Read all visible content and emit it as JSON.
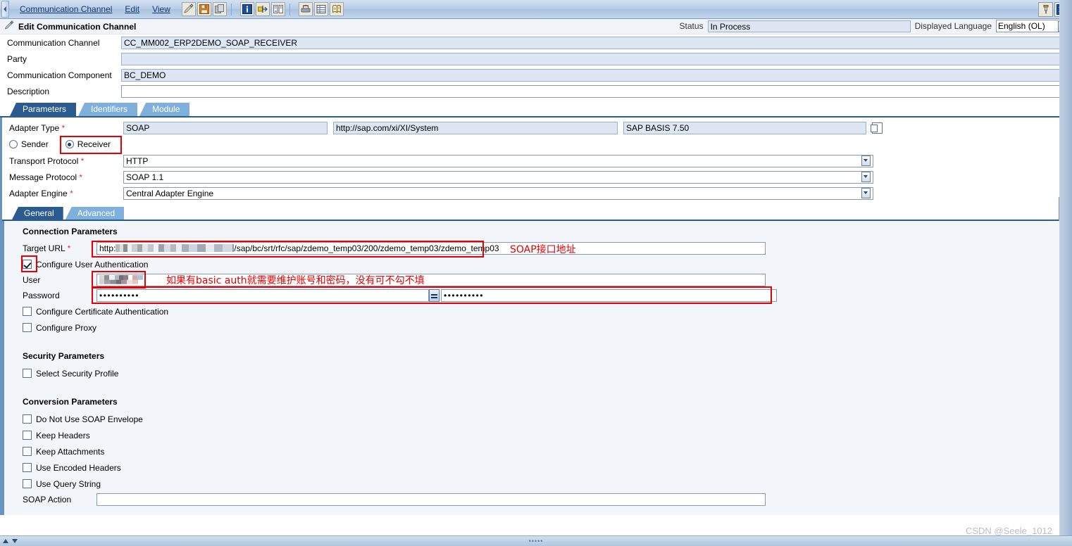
{
  "menu": {
    "items": [
      {
        "label": "Communication Channel",
        "accel": "C"
      },
      {
        "label": "Edit",
        "accel": "d"
      },
      {
        "label": "View",
        "accel": "i"
      }
    ],
    "toolbar_group1": [
      {
        "name": "edit-pencil-icon",
        "title": "Edit"
      },
      {
        "name": "save-icon",
        "title": "Save"
      },
      {
        "name": "copy-icon",
        "title": "Copy"
      }
    ],
    "toolbar_group2": [
      {
        "name": "info-icon",
        "title": "Information"
      },
      {
        "name": "where-used-icon",
        "title": "Where Used"
      },
      {
        "name": "compare-icon",
        "title": "Compare"
      }
    ],
    "toolbar_group3": [
      {
        "name": "print-icon",
        "title": "Print"
      },
      {
        "name": "grid-icon",
        "title": "Table"
      },
      {
        "name": "history-icon",
        "title": "History"
      }
    ],
    "window_controls": [
      {
        "name": "pin-icon",
        "title": "Pin Window"
      },
      {
        "name": "close-icon",
        "title": "Close"
      }
    ]
  },
  "header": {
    "icon": "channel-icon",
    "title": "Edit Communication Channel",
    "status_label": "Status",
    "status_value": "In Process",
    "language_label": "Displayed Language",
    "language_value": "English (OL)"
  },
  "form": {
    "rows": [
      {
        "label": "Communication Channel",
        "value": "CC_MM002_ERP2DEMO_SOAP_RECEIVER",
        "editable": false
      },
      {
        "label": "Party",
        "value": "",
        "editable": false
      },
      {
        "label": "Communication Component",
        "value": "BC_DEMO",
        "editable": false
      },
      {
        "label": "Description",
        "value": "",
        "editable": true
      }
    ]
  },
  "tabs": {
    "items": [
      {
        "label": "Parameters",
        "active": true
      },
      {
        "label": "Identifiers",
        "active": false
      },
      {
        "label": "Module",
        "active": false
      }
    ]
  },
  "parameters": {
    "adapter_type_label": "Adapter Type",
    "adapter_type_value": "SOAP",
    "adapter_namespace": "http://sap.com/xi/XI/System",
    "adapter_swcv": "SAP BASIS 7.50",
    "direction": {
      "sender_label": "Sender",
      "receiver_label": "Receiver",
      "selected": "Receiver"
    },
    "protocol_rows": [
      {
        "label": "Transport Protocol",
        "value": "HTTP"
      },
      {
        "label": "Message Protocol",
        "value": "SOAP 1.1"
      },
      {
        "label": "Adapter Engine",
        "value": "Central Adapter Engine"
      }
    ]
  },
  "inner_tabs": {
    "items": [
      {
        "label": "General",
        "active": true
      },
      {
        "label": "Advanced",
        "active": false
      }
    ]
  },
  "connection": {
    "section_title": "Connection Parameters",
    "target_url_label": "Target URL",
    "target_url_prefix": "http:",
    "target_url_suffix": "/sap/bc/srt/rfc/sap/zdemo_temp03/200/zdemo_temp03/zdemo_temp03",
    "annotation_url": "SOAP接口地址",
    "configure_user_auth_label": "Configure User Authentication",
    "configure_user_auth_checked": true,
    "user_label": "User",
    "user_value": "",
    "annotation_auth": "如果有basic auth就需要维护账号和密码，没有可不勾不填",
    "password_label": "Password",
    "password_value": "••••••••••",
    "password_confirm_value": "••••••••••",
    "equals_button": "=",
    "configure_cert_auth_label": "Configure Certificate Authentication",
    "configure_cert_auth_checked": false,
    "configure_proxy_label": "Configure Proxy",
    "configure_proxy_checked": false
  },
  "security": {
    "section_title": "Security Parameters",
    "select_security_profile_label": "Select Security Profile",
    "select_security_profile_checked": false
  },
  "conversion": {
    "section_title": "Conversion Parameters",
    "checkboxes": [
      {
        "label": "Do Not Use SOAP Envelope",
        "checked": false
      },
      {
        "label": "Keep Headers",
        "checked": false
      },
      {
        "label": "Keep Attachments",
        "checked": false
      },
      {
        "label": "Use Encoded Headers",
        "checked": false
      },
      {
        "label": "Use Query String",
        "checked": false
      }
    ],
    "soap_action_label": "SOAP Action",
    "soap_action_value": ""
  },
  "watermark": "CSDN @Seele_1012",
  "colors": {
    "annotation_red": "#e60000",
    "tab_active": "#2c5b8f",
    "tab_inactive": "#7fb0dc",
    "field_readonly": "#dde6f2"
  }
}
